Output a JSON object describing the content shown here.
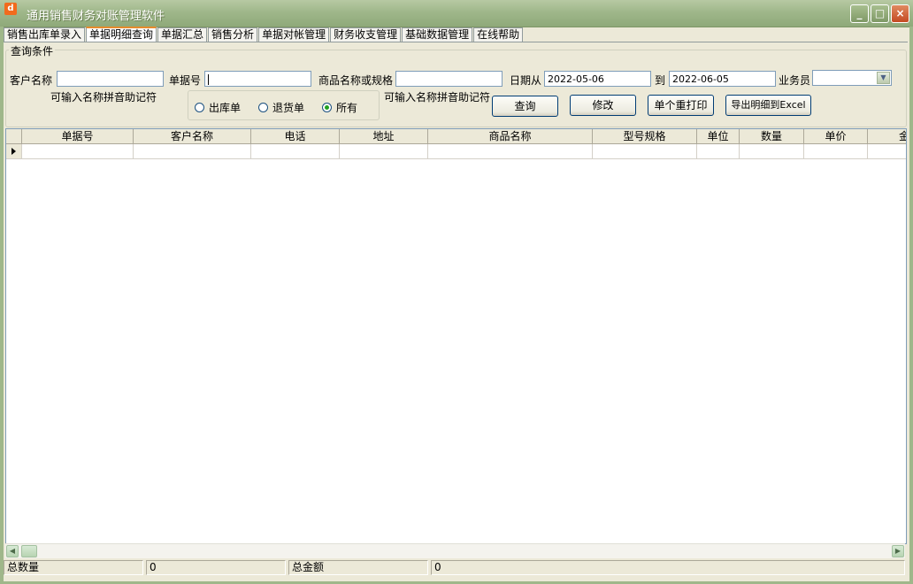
{
  "window": {
    "title": "通用销售财务对账管理软件",
    "icon_glyph": "d",
    "controls": {
      "minimize": "_",
      "maximize": "□",
      "close": "×"
    }
  },
  "tabs": [
    {
      "label": "销售出库单录入",
      "active": false
    },
    {
      "label": "单据明细查询",
      "active": true
    },
    {
      "label": "单据汇总",
      "active": false
    },
    {
      "label": "销售分析",
      "active": false
    },
    {
      "label": "单据对帐管理",
      "active": false
    },
    {
      "label": "财务收支管理",
      "active": false
    },
    {
      "label": "基础数据管理",
      "active": false
    },
    {
      "label": "在线帮助",
      "active": false
    }
  ],
  "query": {
    "group_label": "查询条件",
    "customer_label": "客户名称",
    "customer_value": "",
    "customer_hint": "可输入名称拼音助记符",
    "docno_label": "单据号",
    "docno_value": "",
    "product_label": "商品名称或规格",
    "product_value": "",
    "product_hint": "可输入名称拼音助记符",
    "date_from_label": "日期从",
    "date_from_value": "2022-05-06",
    "date_to_label": "到",
    "date_to_value": "2022-06-05",
    "salesman_label": "业务员",
    "salesman_value": "",
    "radios": [
      {
        "label": "出库单",
        "checked": false
      },
      {
        "label": "退货单",
        "checked": false
      },
      {
        "label": "所有",
        "checked": true
      }
    ],
    "buttons": {
      "search": "查询",
      "edit": "修改",
      "reprint": "单个重打印",
      "export": "导出明细到Excel"
    }
  },
  "grid": {
    "columns": [
      "单据号",
      "客户名称",
      "电话",
      "地址",
      "商品名称",
      "型号规格",
      "单位",
      "数量",
      "单价",
      "金额"
    ]
  },
  "status": {
    "total_qty_label": "总数量",
    "total_qty_value": "0",
    "total_amount_label": "总金额",
    "total_amount_value": "0"
  }
}
